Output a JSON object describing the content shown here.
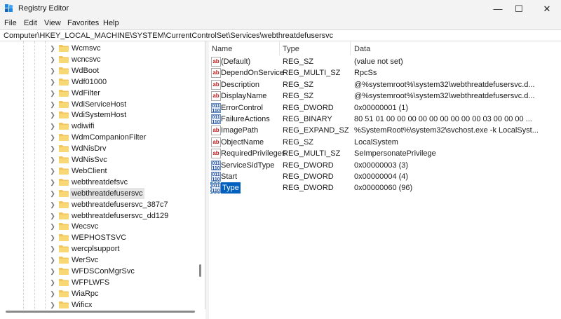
{
  "window": {
    "title": "Registry Editor",
    "controls": [
      "—",
      "☐",
      "✕"
    ]
  },
  "menu": [
    "File",
    "Edit",
    "View",
    "Favorites",
    "Help"
  ],
  "address": "Computer\\HKEY_LOCAL_MACHINE\\SYSTEM\\CurrentControlSet\\Services\\webthreatdefusersvc",
  "tree": {
    "selected_index": 13,
    "items": [
      "Wcmsvc",
      "wcncsvc",
      "WdBoot",
      "Wdf01000",
      "WdFilter",
      "WdiServiceHost",
      "WdiSystemHost",
      "wdiwifi",
      "WdmCompanionFilter",
      "WdNisDrv",
      "WdNisSvc",
      "WebClient",
      "webthreatdefsvc",
      "webthreatdefusersvc",
      "webthreatdefusersvc_387c7",
      "webthreatdefusersvc_dd129",
      "Wecsvc",
      "WEPHOSTSVC",
      "wercplsupport",
      "WerSvc",
      "WFDSConMgrSvc",
      "WFPLWFS",
      "WiaRpc",
      "Wificx"
    ]
  },
  "values": {
    "headers": {
      "name": "Name",
      "type": "Type",
      "data": "Data"
    },
    "selected_index": 11,
    "rows": [
      {
        "name": "(Default)",
        "type": "REG_SZ",
        "data": "(value not set)",
        "icon": "string-value-icon"
      },
      {
        "name": "DependOnService",
        "type": "REG_MULTI_SZ",
        "data": "RpcSs",
        "icon": "string-value-icon"
      },
      {
        "name": "Description",
        "type": "REG_SZ",
        "data": "@%systemroot%\\system32\\webthreatdefusersvc.d...",
        "icon": "string-value-icon"
      },
      {
        "name": "DisplayName",
        "type": "REG_SZ",
        "data": "@%systemroot%\\system32\\webthreatdefusersvc.d...",
        "icon": "string-value-icon"
      },
      {
        "name": "ErrorControl",
        "type": "REG_DWORD",
        "data": "0x00000001 (1)",
        "icon": "binary-value-icon"
      },
      {
        "name": "FailureActions",
        "type": "REG_BINARY",
        "data": "80 51 01 00 00 00 00 00 00 00 00 00 03 00 00 00 ...",
        "icon": "binary-value-icon"
      },
      {
        "name": "ImagePath",
        "type": "REG_EXPAND_SZ",
        "data": "%SystemRoot%\\system32\\svchost.exe -k LocalSyst...",
        "icon": "string-value-icon"
      },
      {
        "name": "ObjectName",
        "type": "REG_SZ",
        "data": "LocalSystem",
        "icon": "string-value-icon"
      },
      {
        "name": "RequiredPrivileges",
        "type": "REG_MULTI_SZ",
        "data": "SeImpersonatePrivilege",
        "icon": "string-value-icon"
      },
      {
        "name": "ServiceSidType",
        "type": "REG_DWORD",
        "data": "0x00000003 (3)",
        "icon": "binary-value-icon"
      },
      {
        "name": "Start",
        "type": "REG_DWORD",
        "data": "0x00000004 (4)",
        "icon": "binary-value-icon"
      },
      {
        "name": "Type",
        "type": "REG_DWORD",
        "data": "0x00000060 (96)",
        "icon": "binary-value-icon"
      }
    ]
  },
  "icon_glyphs": {
    "string": "ab",
    "binary": "011\n110"
  },
  "colors": {
    "selection": "#0060c0",
    "folder": "#f2c55c",
    "tree_selection": "#e5e5e5"
  }
}
